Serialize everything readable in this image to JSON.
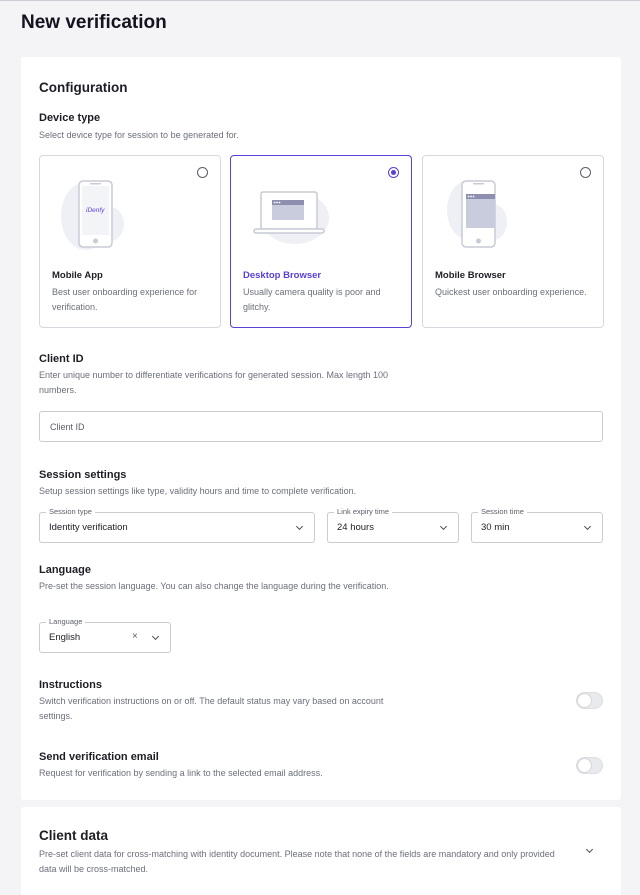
{
  "page": {
    "title": "New verification"
  },
  "configuration": {
    "title": "Configuration",
    "device_type": {
      "title": "Device type",
      "description": "Select device type for session to be generated for.",
      "options": [
        {
          "name": "Mobile App",
          "description": "Best user onboarding experience for verification.",
          "selected": false,
          "illustration_text": "iDenfy"
        },
        {
          "name": "Desktop Browser",
          "description": "Usually camera quality is poor and glitchy.",
          "selected": true
        },
        {
          "name": "Mobile Browser",
          "description": "Quickest user onboarding experience.",
          "selected": false
        }
      ]
    },
    "client_id": {
      "title": "Client ID",
      "description": "Enter unique number to differentiate verifications for generated session. Max length 100 numbers.",
      "placeholder": "Client ID",
      "value": ""
    },
    "session_settings": {
      "title": "Session settings",
      "description": "Setup session settings like type, validity hours and time to complete verification.",
      "session_type": {
        "label": "Session type",
        "value": "Identity verification"
      },
      "link_expiry": {
        "label": "Link expiry time",
        "value": "24 hours"
      },
      "session_time": {
        "label": "Session time",
        "value": "30 min"
      }
    },
    "language": {
      "title": "Language",
      "description": "Pre-set the session language. You can also change the language during the verification.",
      "label": "Language",
      "value": "English",
      "clear_symbol": "×"
    },
    "instructions": {
      "title": "Instructions",
      "description": "Switch verification instructions on or off. The default status may vary based on account settings.",
      "enabled": false
    },
    "send_email": {
      "title": "Send verification email",
      "description": "Request for verification by sending a link to the selected email address.",
      "enabled": false
    }
  },
  "client_data": {
    "title": "Client data",
    "description": "Pre-set client data for cross-matching with identity document. Please note that none of the fields are mandatory and only provided data will be cross-matched.",
    "expanded": false
  },
  "colors": {
    "accent": "#5b3fd6",
    "border": "#c9ccd3",
    "background": "#f4f4f6",
    "muted_text": "#6b6f7b"
  },
  "icons": [
    "radio-unselected",
    "radio-selected",
    "chevron-down-icon",
    "clear-icon",
    "phone-illustration",
    "laptop-illustration",
    "mobile-browser-illustration"
  ]
}
